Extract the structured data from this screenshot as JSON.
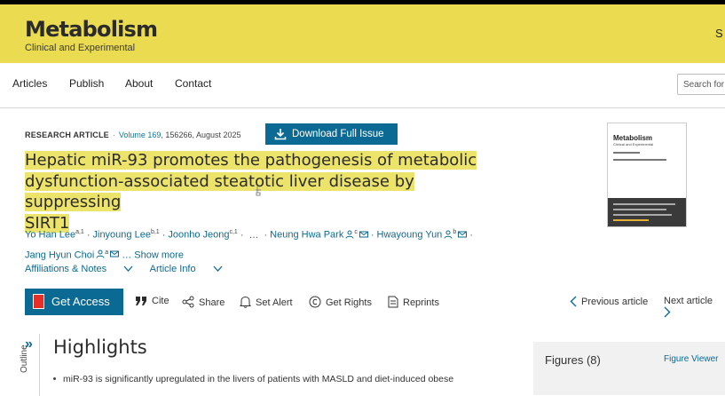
{
  "journal": {
    "title": "Metabolism",
    "subtitle": "Clinical and Experimental",
    "header_right_text": "S"
  },
  "nav": {
    "items": [
      "Articles",
      "Publish",
      "About",
      "Contact"
    ],
    "search_placeholder": "Search for"
  },
  "article": {
    "type": "RESEARCH ARTICLE",
    "volume": "Volume 169",
    "details": ", 156266, August 2025",
    "download_label": "Download Full Issue",
    "title_lines": [
      "Hepatic miR-93 promotes the pathogenesis of metabolic",
      "dysfunction-associated steatotic liver disease by suppressing",
      "SIRT1"
    ],
    "authors": [
      {
        "name": "Yo Han Lee",
        "sup": "a,1"
      },
      {
        "name": "Jinyoung Lee",
        "sup": "b,1"
      },
      {
        "name": "Joonho Jeong",
        "sup": "c,1"
      },
      {
        "name": "Neung Hwa Park",
        "sup": "c"
      },
      {
        "name": "Hwayoung Yun",
        "sup": "b"
      },
      {
        "name": "Jang Hyun Choi",
        "sup": "a"
      }
    ],
    "ellipsis": "…",
    "show_more": "… Show more",
    "affiliations_label": "Affiliations & Notes",
    "article_info_label": "Article Info"
  },
  "actions": {
    "get_access": "Get Access",
    "cite": "Cite",
    "share": "Share",
    "set_alert": "Set Alert",
    "get_rights": "Get Rights",
    "reprints": "Reprints",
    "previous": "Previous article",
    "next": "Next article"
  },
  "cover": {
    "logo": "Metabolism",
    "sub": "Clinical and Experimental"
  },
  "outline": {
    "label": "Outline"
  },
  "highlights": {
    "heading": "Highlights",
    "first_bullet": "miR-93 is significantly upregulated in the livers of patients with MASLD and diet-induced obese"
  },
  "figures": {
    "title": "Figures (8)",
    "viewer_label": "Figure Viewer"
  },
  "colors": {
    "header_yellow": "#eadb50",
    "highlight": "#ece46a",
    "primary_blue": "#0b6a93",
    "link_blue": "#0c6a93"
  }
}
